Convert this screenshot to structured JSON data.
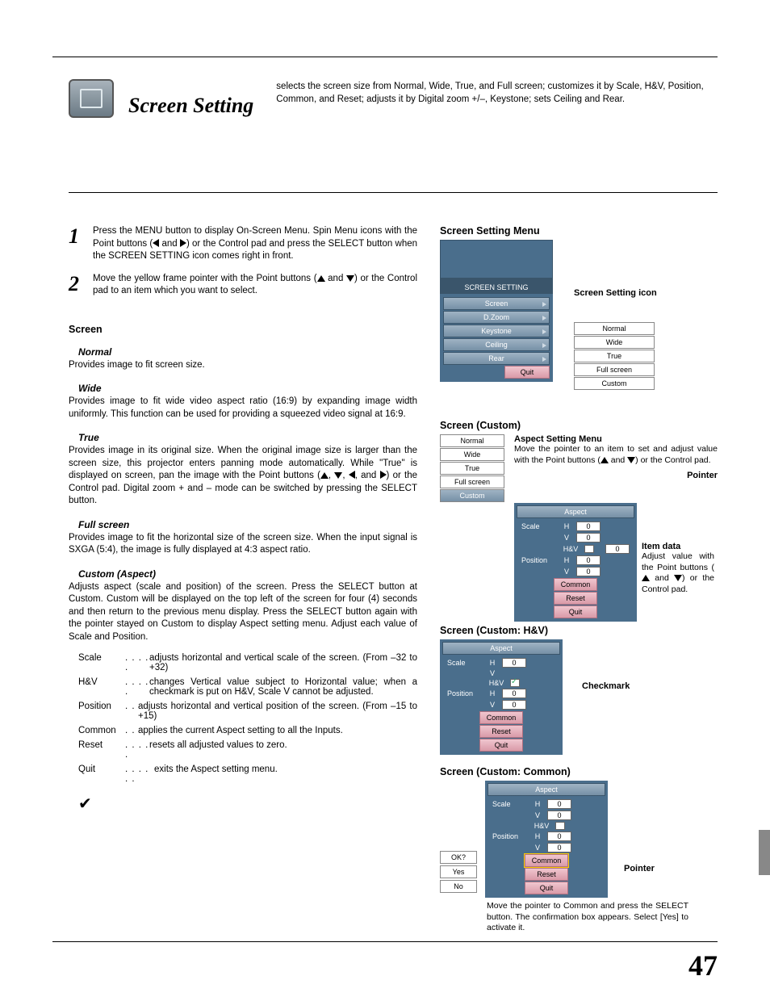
{
  "pageNumber": "47",
  "title": "Screen Setting",
  "intro": "selects the screen size from Normal, Wide, True, and Full screen; customizes it by Scale, H&V, Position, Common, and Reset; adjusts it by Digital zoom +/–, Keystone; sets Ceiling and Rear.",
  "steps": {
    "s1": "Press the MENU button to display On-Screen Menu. Spin Menu icons with the Point buttons (◀ and ▶) or the Control pad and press the SELECT button when the SCREEN SETTING icon comes right in front.",
    "s2": "Move the yellow frame pointer with the Point buttons (▲ and ▼) or the Control pad to an item which you want to select."
  },
  "sections": {
    "screen": "Screen",
    "normal_h": "Normal",
    "normal_p": "Provides image to fit screen size.",
    "wide_h": "Wide",
    "wide_p": "Provides image to fit wide video aspect ratio (16:9) by expanding image width uniformly. This function can be used for providing a squeezed video signal at 16:9.",
    "true_h": "True",
    "true_p": "Provides image in its original size. When the original image size is larger than the screen size, this projector enters panning mode automatically. While \"True\" is displayed on screen, pan the image with the Point buttons (▲, ▼, ◀, and ▶) or the Control pad. Digital zoom + and – mode can be switched by pressing the SELECT button.",
    "full_h": "Full screen",
    "full_p": "Provides image to fit the horizontal size of the screen size. When the input signal is SXGA (5:4), the image is fully displayed at 4:3 aspect ratio.",
    "custom_h": "Custom (Aspect)",
    "custom_p": "Adjusts aspect (scale and position) of the screen. Press the SELECT button at Custom. Custom will be displayed on the top left of the screen for four (4) seconds and then return to the previous menu display. Press the SELECT button again with the pointer stayed on Custom to display Aspect setting menu. Adjust each value of Scale and Position."
  },
  "dl": {
    "scale_t": "Scale",
    "scale_d": "adjusts horizontal and vertical scale of the screen. (From –32 to +32)",
    "hv_t": "H&V",
    "hv_d": "changes Vertical value subject to Horizontal value; when a checkmark is put on H&V, Scale V cannot be adjusted.",
    "pos_t": "Position",
    "pos_d": "adjusts horizontal and vertical position of the screen. (From –15 to +15)",
    "com_t": "Common",
    "com_d": "applies the current Aspect setting to all the Inputs.",
    "res_t": "Reset",
    "res_d": "resets all adjusted values to zero.",
    "quit_t": "Quit",
    "quit_d": "exits the Aspect setting menu."
  },
  "right": {
    "menu_h": "Screen Setting Menu",
    "icon_callout": "Screen Setting icon",
    "menu_label": "SCREEN SETTING",
    "items": [
      "Screen",
      "D.Zoom",
      "Keystone",
      "Ceiling",
      "Rear"
    ],
    "quit": "Quit",
    "sub": [
      "Normal",
      "Wide",
      "True",
      "Full screen",
      "Custom"
    ],
    "custom_h": "Screen (Custom)",
    "aspect_h": "Aspect Setting Menu",
    "aspect_p": "Move the pointer to an item to set and adjust value with the Point buttons (▲ and ▼) or the Control pad.",
    "pointer": "Pointer",
    "item_data_h": "Item data",
    "item_data_p": "Adjust value with the Point buttons (▲ and ▼) or the Control pad.",
    "aspect_rows": {
      "aspect": "Aspect",
      "scale": "Scale",
      "position": "Position",
      "h": "H",
      "v": "V",
      "hv": "H&V",
      "common": "Common",
      "reset": "Reset",
      "quit": "Quit",
      "val0": "0"
    },
    "hv_h": "Screen (Custom: H&V)",
    "checkmark": "Checkmark",
    "common_h": "Screen (Custom: Common)",
    "common_p": "Move the pointer to Common and press the SELECT button. The confirmation box appears. Select [Yes] to activate it.",
    "ok": "OK?",
    "yes": "Yes",
    "no": "No"
  }
}
